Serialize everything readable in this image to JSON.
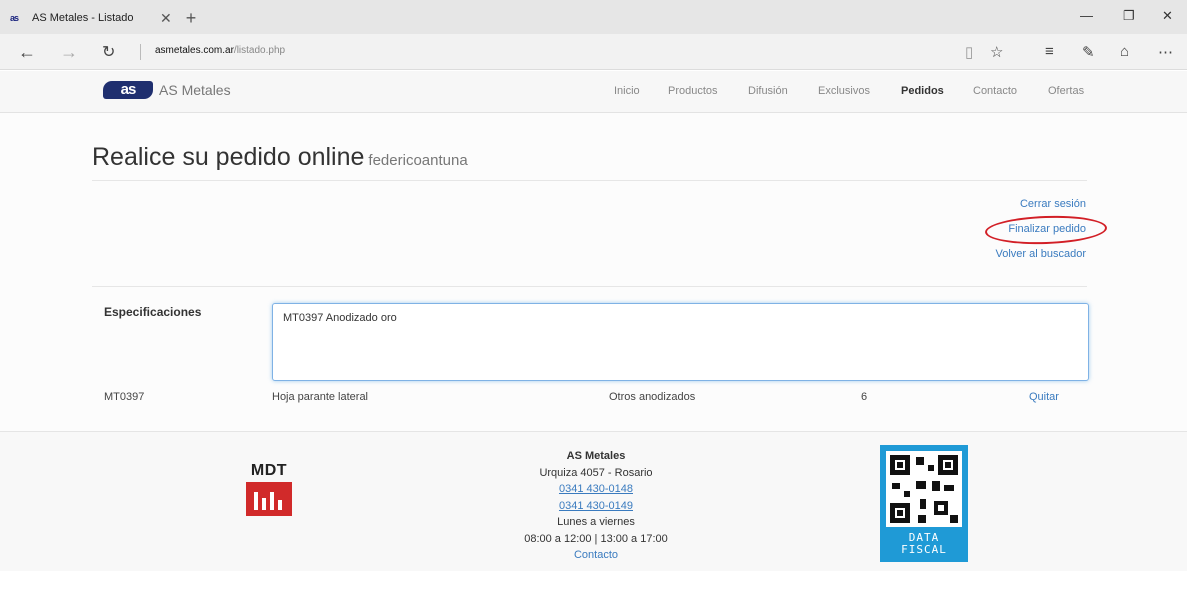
{
  "browser": {
    "tab_title": "AS Metales - Listado",
    "tab_favicon": "as",
    "url_host": "asmetales.com.ar",
    "url_path": "/listado.php",
    "icons": [
      "back-icon",
      "forward-icon",
      "refresh-icon",
      "reading-view-icon",
      "favorite-star-icon",
      "hub-icon",
      "web-note-icon",
      "share-icon",
      "more-icon"
    ]
  },
  "site": {
    "brand_logo": "as",
    "brand_name": "AS Metales",
    "nav": [
      "Inicio",
      "Productos",
      "Difusión",
      "Exclusivos",
      "Pedidos",
      "Contacto",
      "Ofertas"
    ],
    "active_nav": "Pedidos",
    "brand_color": "#1f2f6f",
    "link_color": "#3a7bbf"
  },
  "page": {
    "title": "Realice su pedido online",
    "username": "federicoantuna",
    "links": {
      "logout": "Cerrar sesión",
      "finish": "Finalizar pedido",
      "back": "Volver al buscador"
    },
    "spec_label": "Especificaciones",
    "spec_value": "MT0397 Anodizado oro",
    "order_row": {
      "code": "MT0397",
      "description": "Hoja parante lateral",
      "category": "Otros anodizados",
      "quantity": "6",
      "remove": "Quitar"
    }
  },
  "footer": {
    "mdt_label": "MDT",
    "company": "AS Metales",
    "address": "Urquiza 4057 - Rosario",
    "phone1": "0341 430-0148",
    "phone2": "0341 430-0149",
    "days": "Lunes a viernes",
    "hours": "08:00 a 12:00 | 13:00 a 17:00",
    "contact": "Contacto",
    "datafiscal_line1": "DATA",
    "datafiscal_line2": "FISCAL"
  }
}
